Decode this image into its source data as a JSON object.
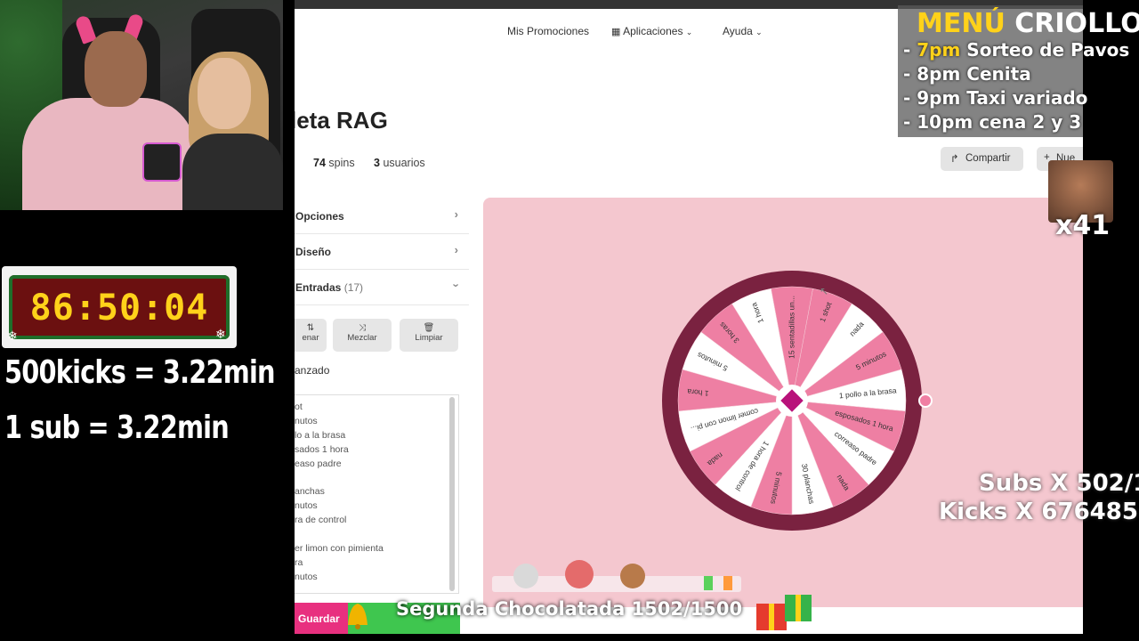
{
  "overlay": {
    "timer": "86:50:04",
    "kicks_rate": "500kicks = 3.22min",
    "sub_rate": "1 sub = 3.22min",
    "menu_title_yellow": "MENÚ",
    "menu_title_white": "CRIOLLO",
    "menu_items": [
      {
        "time": "7pm",
        "text": "Sorteo de Pavos",
        "highlight": true
      },
      {
        "time": "8pm",
        "text": "Cenita",
        "highlight": false
      },
      {
        "time": "9pm",
        "text": "Taxi variado",
        "highlight": false
      },
      {
        "time": "10pm",
        "text": "cena 2 y 3",
        "highlight": false
      }
    ],
    "multiplier": "x41",
    "subs": "Subs X 502/1",
    "kicks": "Kicks X 676485",
    "banner": "Segunda Chocolatada 1502/1500"
  },
  "nav": {
    "promos": "Mis Promociones",
    "apps": "Aplicaciones",
    "help": "Ayuda"
  },
  "page": {
    "title": "leta RAG",
    "spins_count": "74",
    "spins_label": "spins",
    "users_count": "3",
    "users_label": "usuarios",
    "share_button": "Compartir",
    "new_button": "Nue"
  },
  "sidebar": {
    "options": "Opciones",
    "design": "Diseño",
    "entries": "Entradas",
    "entries_count": "(17)",
    "fill_button": "enar",
    "shuffle_button": "Mezclar",
    "clear_button": "Limpiar",
    "advanced": "anzado",
    "save_button": "Guardar",
    "entries_list": [
      "ot",
      "nutos",
      "lo a la brasa",
      "sados 1 hora",
      "easo padre",
      "",
      "anchas",
      "nutos",
      "ra de control",
      "",
      "er limon con pimienta",
      "ra",
      "nutos"
    ]
  },
  "wheel": {
    "segments": [
      "1 shot",
      "nada",
      "5 minutos",
      "1 pollo a la brasa",
      "esposados 1 hora",
      "correaso padre",
      "nada",
      "30 planchas",
      "5 minutos",
      "1 hora de control",
      "nada",
      "comer limon con pi...",
      "1 hora",
      "5 minutos",
      "3 horas",
      "1 hora",
      "15 sentadillas un..."
    ],
    "colors": {
      "pink": "#ee7fa3",
      "white": "#ffffff",
      "rim": "#7a2240",
      "hub": "#b8127a",
      "pointer": "#f07fa3"
    }
  }
}
